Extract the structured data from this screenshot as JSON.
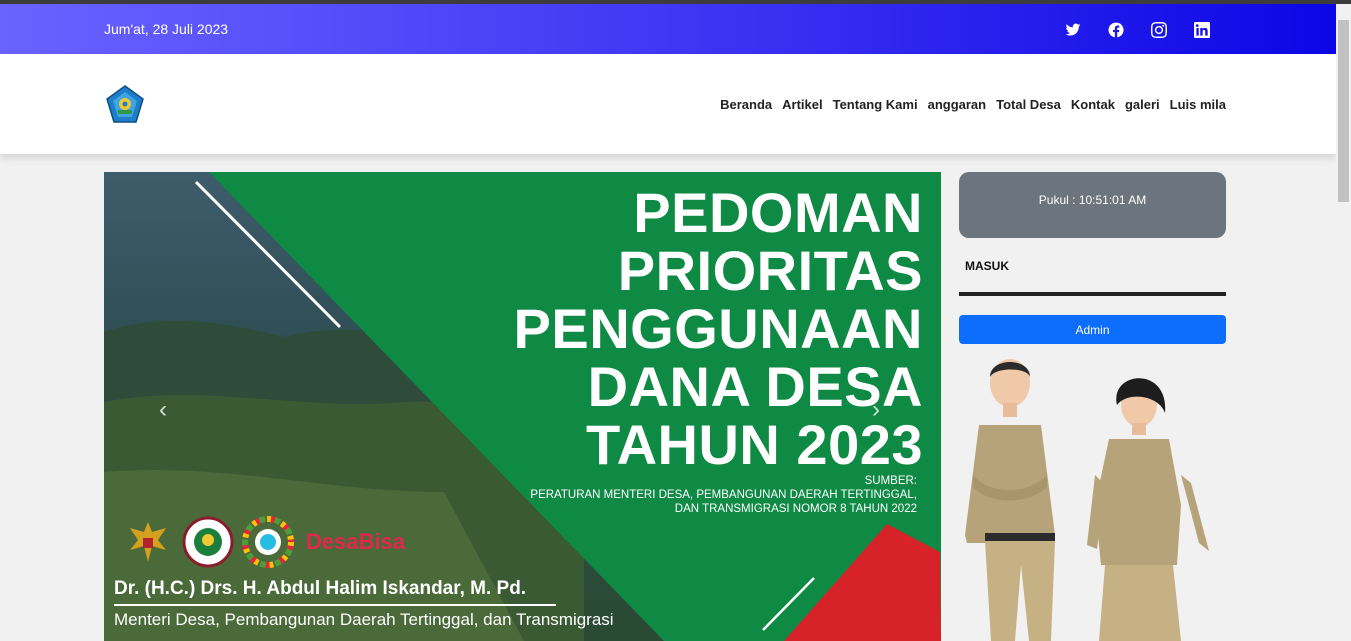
{
  "topbar": {
    "date": "Jum'at, 28 Juli 2023",
    "social": [
      "twitter-icon",
      "facebook-icon",
      "instagram-icon",
      "linkedin-icon"
    ]
  },
  "nav": {
    "items": [
      "Beranda",
      "Artikel",
      "Tentang Kami",
      "anggaran",
      "Total Desa",
      "Kontak",
      "galeri",
      "Luis mila"
    ]
  },
  "banner": {
    "headline": [
      "PEDOMAN",
      "PRIORITAS",
      "PENGGUNAAN",
      "DANA DESA",
      "TAHUN 2023"
    ],
    "source_label": "SUMBER:",
    "source_lines": [
      "PERATURAN MENTERI DESA, PEMBANGUNAN DAERAH TERTINGGAL,",
      "DAN TRANSMIGRASI NOMOR 8 TAHUN 2022"
    ],
    "brand": "DesaBisa",
    "minister_name": "Dr. (H.C.) Drs. H. Abdul Halim Iskandar, M. Pd.",
    "minister_title": "Menteri Desa, Pembangunan Daerah Tertinggal, dan Transmigrasi",
    "prev_arrow": "‹",
    "next_arrow": "›"
  },
  "sidebar": {
    "clock": "Pukul : 10:51:01 AM",
    "login_heading": "MASUK",
    "admin_button": "Admin"
  },
  "colors": {
    "topbar_start": "#6a63ff",
    "topbar_end": "#0c06e6",
    "banner_green": "#0f8a45",
    "banner_red": "#d8222a",
    "admin_blue": "#0d6efd",
    "clock_gray": "#6c757d"
  }
}
